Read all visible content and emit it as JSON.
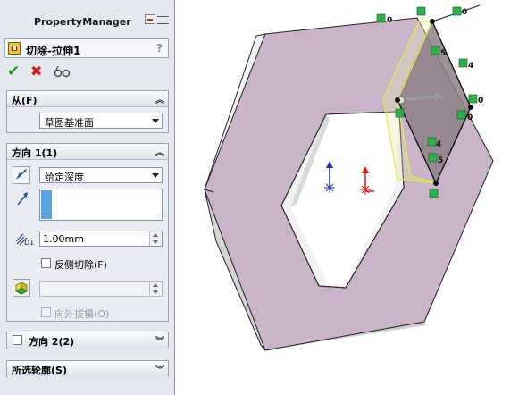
{
  "panel": {
    "title": "PropertyManager",
    "feature_title": "切除-拉伸1",
    "help": "?",
    "actions": {
      "ok": "✔",
      "cancel": "✖",
      "preview": "6ℴ"
    }
  },
  "from_group": {
    "label": "从(F)",
    "selected": "草图基准面"
  },
  "direction1": {
    "label": "方向 1(1)",
    "end_condition": "给定深度",
    "depth": "1.00mm",
    "depth_symbol": "D1",
    "flip_side_label": "反侧切除(F)",
    "draft_label": "向外拔模(O)"
  },
  "direction2": {
    "label": "方向 2(2)"
  },
  "selected_contours": {
    "label": "所选轮廓(S)"
  },
  "viewport": {
    "dimension_labels": [
      "0",
      "0",
      "5",
      "4",
      "0",
      "4",
      "5",
      "0"
    ],
    "colors": {
      "face": "#c9b4c9",
      "side_light": "#f2f2f2",
      "side_shadow": "#d8d8d8",
      "edge": "#222222",
      "preview": "#e8e830"
    }
  }
}
